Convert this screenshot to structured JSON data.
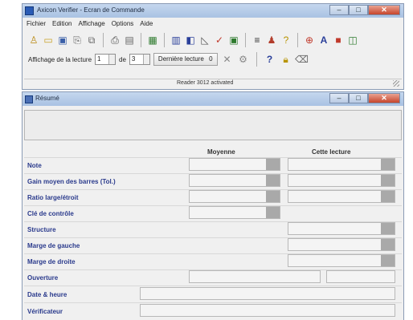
{
  "main_window": {
    "title": "Axicon Verifier - Ecran de Commande",
    "menu": [
      "Fichier",
      "Edition",
      "Affichage",
      "Options",
      "Aide"
    ],
    "nav": {
      "label_affichage": "Affichage de la lecture",
      "current": "1",
      "label_de": "de",
      "total": "3",
      "derniere": "Dernière lecture",
      "extra": "0"
    },
    "status": "Reader 3012 activated"
  },
  "resume_window": {
    "title": "Résumé",
    "columns": {
      "moyenne": "Moyenne",
      "cette": "Cette lecture"
    },
    "rows": [
      "Note",
      "Gain moyen des barres (Tol.)",
      "Ratio large/étroit",
      "Clé de contrôle",
      "Structure",
      "Marge de gauche",
      "Marge de droite",
      "Ouverture",
      "Date & heure",
      "Vérificateur"
    ]
  }
}
